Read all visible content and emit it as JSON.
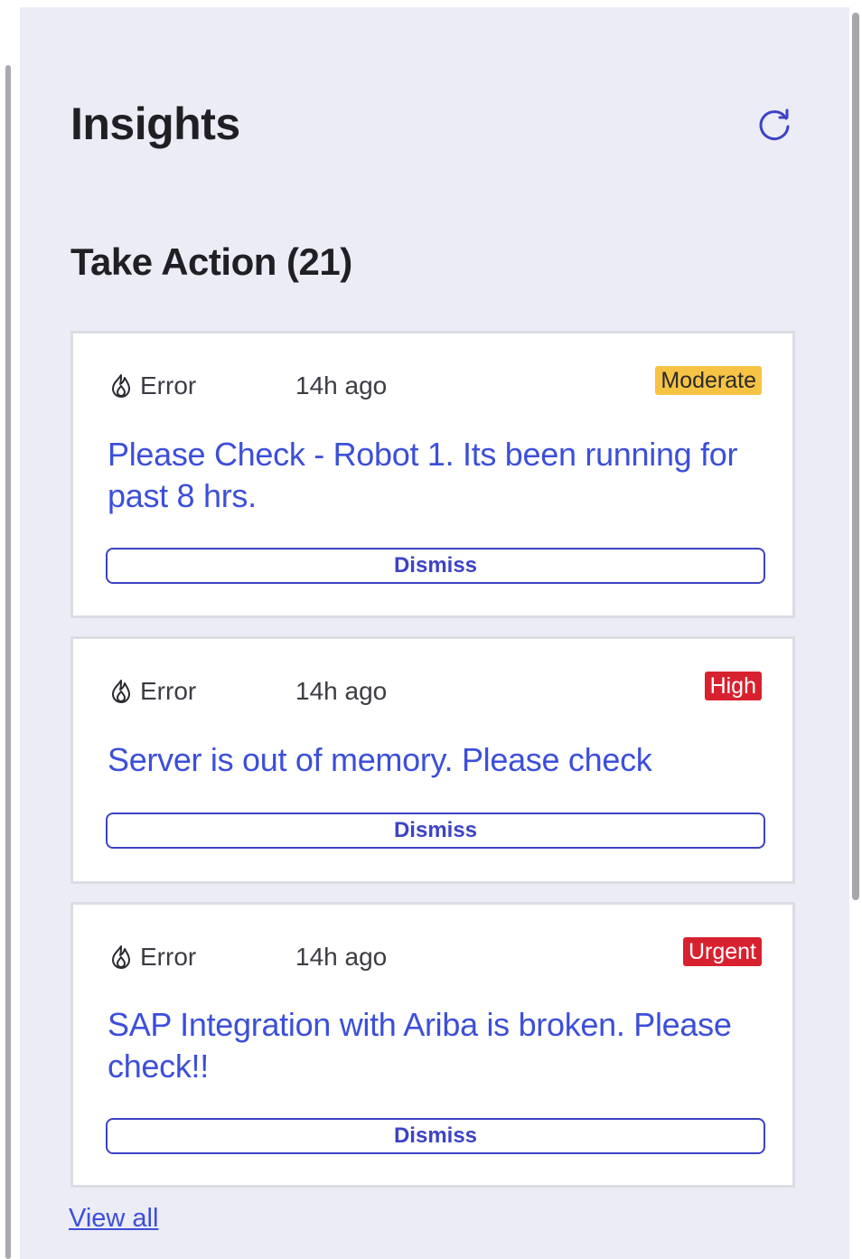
{
  "header": {
    "title": "Insights",
    "refresh_icon": "refresh-icon"
  },
  "section": {
    "title": "Take Action (21)"
  },
  "cards": [
    {
      "type_icon": "flame-icon",
      "type": "Error",
      "time": "14h ago",
      "severity": "Moderate",
      "severity_color": "#f6c344",
      "message": "Please Check - Robot 1. Its been running for past 8 hrs.",
      "dismiss_label": "Dismiss"
    },
    {
      "type_icon": "flame-icon",
      "type": "Error",
      "time": "14h ago",
      "severity": "High",
      "severity_color": "#d8212f",
      "message": "Server is out of memory. Please check",
      "dismiss_label": "Dismiss"
    },
    {
      "type_icon": "flame-icon",
      "type": "Error",
      "time": "14h ago",
      "severity": "Urgent",
      "severity_color": "#d8212f",
      "message": "SAP Integration with Ariba is broken. Please check!!",
      "dismiss_label": "Dismiss"
    }
  ],
  "footer": {
    "view_all_label": "View all"
  },
  "colors": {
    "panel_background": "#ececf6",
    "link": "#3c4fd9",
    "button_border": "#3d43c4"
  }
}
